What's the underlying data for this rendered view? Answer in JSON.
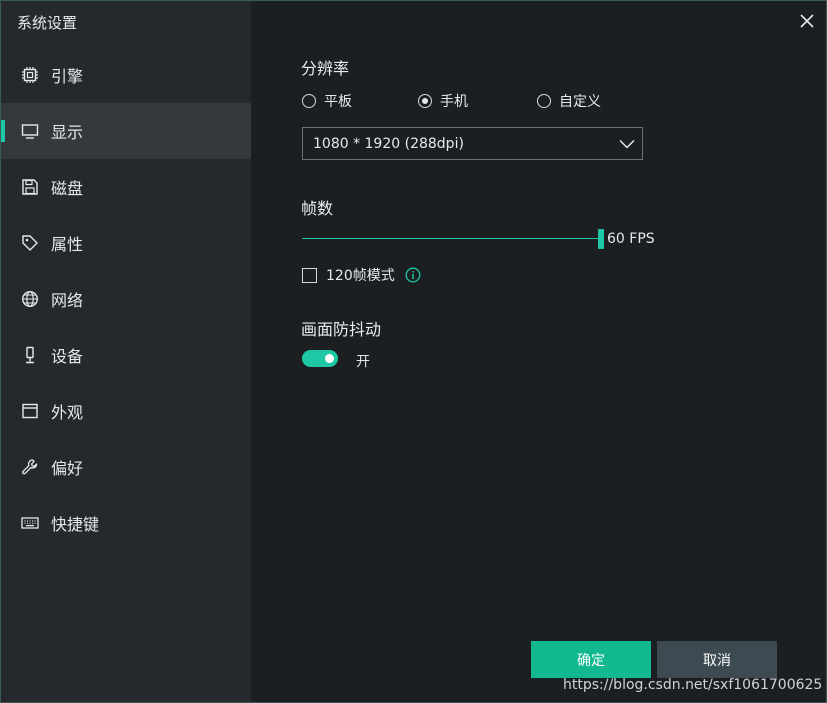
{
  "window": {
    "title": "系统设置"
  },
  "sidebar": {
    "items": [
      {
        "label": "引擎",
        "icon": "cpu-icon"
      },
      {
        "label": "显示",
        "icon": "monitor-icon",
        "active": true
      },
      {
        "label": "磁盘",
        "icon": "floppy-disk-icon"
      },
      {
        "label": "属性",
        "icon": "tag-icon"
      },
      {
        "label": "网络",
        "icon": "globe-icon"
      },
      {
        "label": "设备",
        "icon": "microphone-icon"
      },
      {
        "label": "外观",
        "icon": "window-icon"
      },
      {
        "label": "偏好",
        "icon": "wrench-icon"
      },
      {
        "label": "快捷键",
        "icon": "keyboard-icon"
      }
    ]
  },
  "resolution": {
    "title": "分辨率",
    "options": [
      {
        "label": "平板",
        "checked": false
      },
      {
        "label": "手机",
        "checked": true
      },
      {
        "label": "自定义",
        "checked": false
      }
    ],
    "selected": "1080 * 1920 (288dpi)"
  },
  "framerate": {
    "title": "帧数",
    "value_label": "60 FPS",
    "slider_fraction": 1.0,
    "mode_120_label": "120帧模式",
    "mode_120_checked": false
  },
  "antishake": {
    "title": "画面防抖动",
    "state_label": "开",
    "enabled": true
  },
  "buttons": {
    "ok": "确定",
    "cancel": "取消"
  },
  "watermark": "https://blog.csdn.net/sxf1061700625",
  "colors": {
    "accent": "#1ec8a5",
    "ok_button": "#12b890",
    "cancel_button": "#3d4a52"
  }
}
